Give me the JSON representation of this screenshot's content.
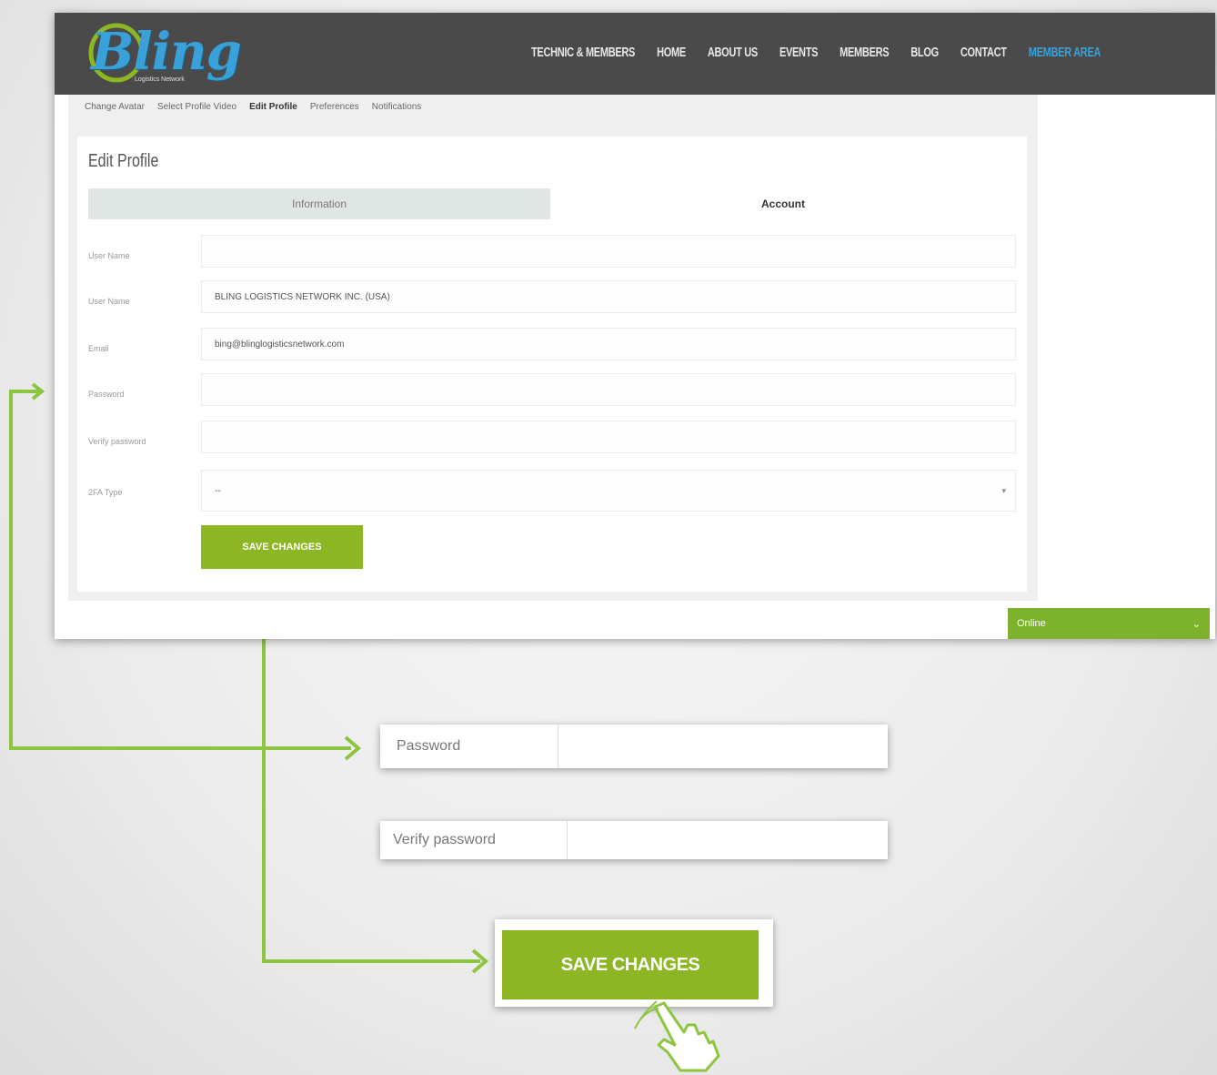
{
  "logo": {
    "text": "Bling",
    "subtext": "Logistics Network"
  },
  "nav": {
    "items": [
      "TECHNIC & MEMBERS",
      "HOME",
      "ABOUT US",
      "EVENTS",
      "MEMBERS",
      "BLOG",
      "CONTACT"
    ],
    "active": "MEMBER AREA"
  },
  "subnav": {
    "items": [
      "Change Avatar",
      "Select Profile Video",
      "Edit Profile",
      "Preferences",
      "Notifications"
    ]
  },
  "panel": {
    "title": "Edit Profile",
    "tab_information": "Information",
    "tab_account": "Account"
  },
  "form": {
    "fields": [
      {
        "label": "User Name",
        "value": ""
      },
      {
        "label": "User Name",
        "value": "BLING LOGISTICS NETWORK INC. (USA)"
      },
      {
        "label": "Email",
        "value": "bing@blinglogisticsnetwork.com"
      },
      {
        "label": "Password",
        "value": ""
      },
      {
        "label": "Verify password",
        "value": ""
      },
      {
        "label": "2FA Type",
        "value": "--"
      }
    ],
    "save_label": "SAVE CHANGES"
  },
  "online": {
    "label": "Online"
  },
  "callouts": {
    "password_label": "Password",
    "verify_label": "Verify password",
    "save_label": "SAVE CHANGES"
  },
  "colors": {
    "accent_green": "#8db624",
    "topbar": "#4a4a4a",
    "nav_active": "#3aa0d8"
  }
}
